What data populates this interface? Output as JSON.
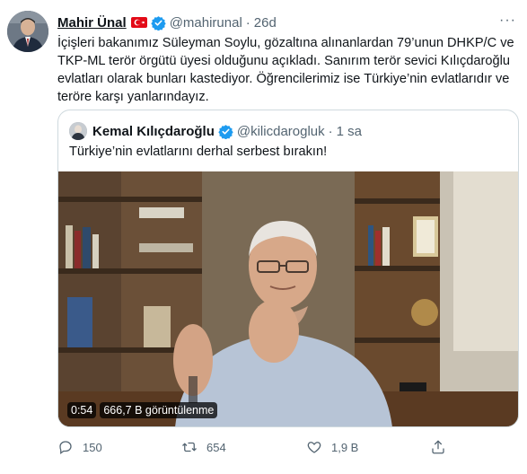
{
  "tweet": {
    "author_name": "Mahir Ünal",
    "handle": "@mahirunal",
    "separator": "·",
    "time": "26d",
    "more": "···",
    "text": "İçişleri bakanımız Süleyman Soylu, gözaltına alınanlardan 79’unun DHKP/C ve TKP-ML terör örgütü üyesi olduğunu açıkladı. Sanırım terör sevici Kılıçdaroğlu evlatları olarak bunları kastediyor. Öğrencilerimiz ise Türkiye’nin evlatlarıdır ve teröre karşı yanlarındayız."
  },
  "quoted": {
    "author_name": "Kemal Kılıçdaroğlu",
    "handle": "@kilicdarogluk",
    "separator": "·",
    "time": "1 sa",
    "text": "Türkiye’nin evlatlarını derhal serbest bırakın!",
    "video": {
      "duration": "0:54",
      "views": "666,7 B görüntülenme"
    }
  },
  "actions": {
    "replies": "150",
    "retweets": "654",
    "likes": "1,9 B"
  },
  "colors": {
    "verified": "#1d9bf0",
    "muted": "#536471",
    "flag": "#e30a17",
    "border": "#cfd9de"
  },
  "icons": [
    "verified-badge-icon",
    "turkish-flag-icon",
    "more-icon",
    "reply-icon",
    "retweet-icon",
    "like-icon",
    "share-icon"
  ]
}
